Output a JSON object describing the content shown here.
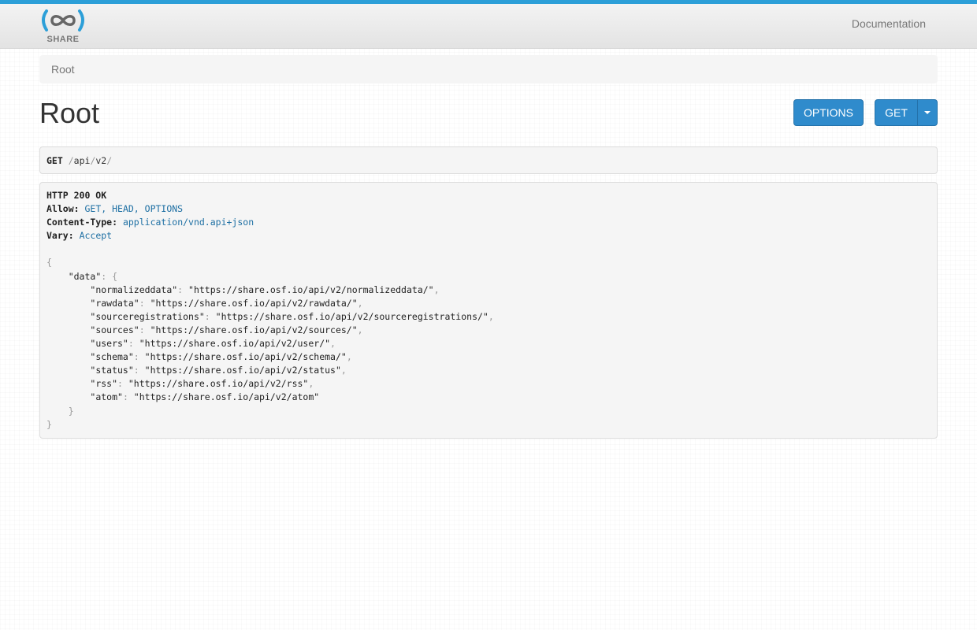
{
  "brand": {
    "name": "SHARE",
    "accent": "#2c9fd8",
    "logo_icon": "share-infinity-logo"
  },
  "nav": {
    "documentation": "Documentation"
  },
  "breadcrumb": {
    "root": "Root"
  },
  "page": {
    "title": "Root"
  },
  "buttons": {
    "options": "OPTIONS",
    "get": "GET"
  },
  "request": {
    "method": "GET",
    "path_parts": [
      "api",
      "v2"
    ]
  },
  "response": {
    "status_line": "HTTP 200 OK",
    "headers": [
      {
        "name": "Allow:",
        "value": "GET, HEAD, OPTIONS"
      },
      {
        "name": "Content-Type:",
        "value": "application/vnd.api+json"
      },
      {
        "name": "Vary:",
        "value": "Accept"
      }
    ],
    "root_key": "\"data\"",
    "entries": [
      {
        "key": "\"normalizeddata\"",
        "value": "\"https://share.osf.io/api/v2/normalizeddata/\""
      },
      {
        "key": "\"rawdata\"",
        "value": "\"https://share.osf.io/api/v2/rawdata/\""
      },
      {
        "key": "\"sourceregistrations\"",
        "value": "\"https://share.osf.io/api/v2/sourceregistrations/\""
      },
      {
        "key": "\"sources\"",
        "value": "\"https://share.osf.io/api/v2/sources/\""
      },
      {
        "key": "\"users\"",
        "value": "\"https://share.osf.io/api/v2/user/\""
      },
      {
        "key": "\"schema\"",
        "value": "\"https://share.osf.io/api/v2/schema/\""
      },
      {
        "key": "\"status\"",
        "value": "\"https://share.osf.io/api/v2/status\""
      },
      {
        "key": "\"rss\"",
        "value": "\"https://share.osf.io/api/v2/rss\""
      },
      {
        "key": "\"atom\"",
        "value": "\"https://share.osf.io/api/v2/atom\""
      }
    ]
  }
}
